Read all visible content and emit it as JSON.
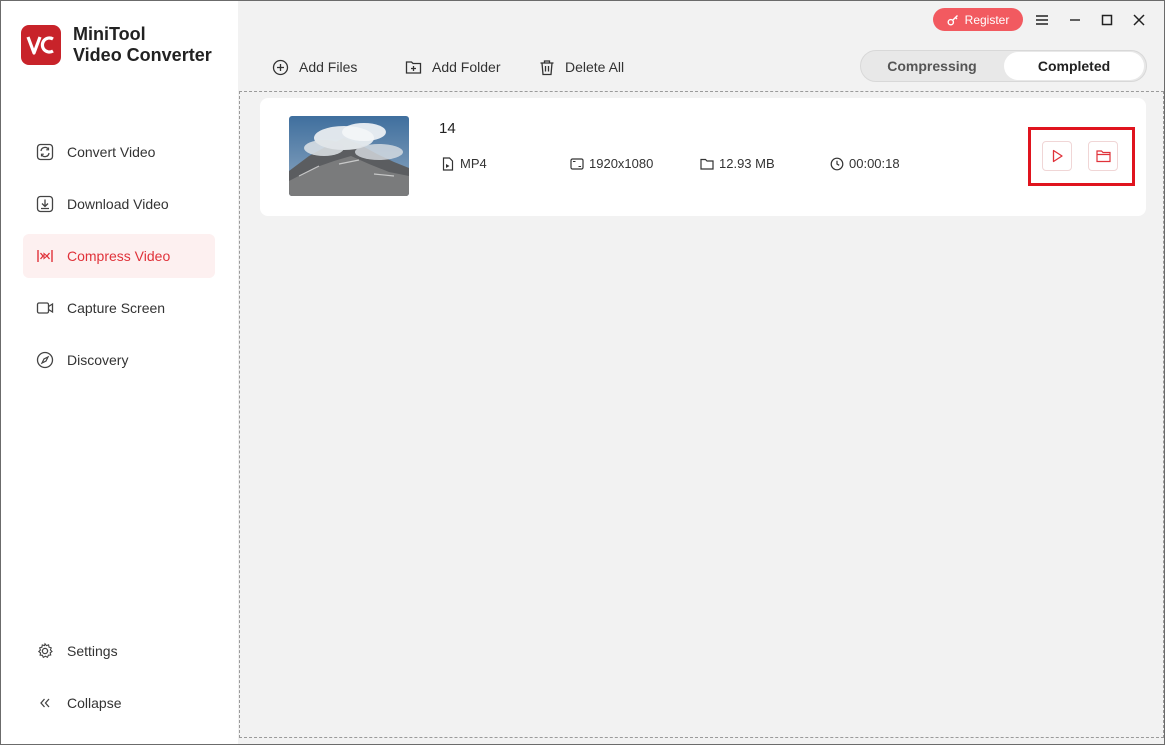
{
  "app": {
    "name_line1": "MiniTool",
    "name_line2": "Video Converter",
    "logo_text": "VC",
    "accent_color": "#e0323a",
    "logo_color": "#c8232a"
  },
  "sidebar": {
    "items": [
      {
        "label": "Convert Video",
        "icon": "convert-icon"
      },
      {
        "label": "Download Video",
        "icon": "download-icon"
      },
      {
        "label": "Compress Video",
        "icon": "compress-icon",
        "active": true
      },
      {
        "label": "Capture Screen",
        "icon": "camera-icon"
      },
      {
        "label": "Discovery",
        "icon": "compass-icon"
      }
    ],
    "bottom": [
      {
        "label": "Settings",
        "icon": "gear-icon"
      },
      {
        "label": "Collapse",
        "icon": "collapse-icon"
      }
    ]
  },
  "titlebar": {
    "register_label": "Register"
  },
  "toolbar": {
    "add_files": "Add Files",
    "add_folder": "Add Folder",
    "delete_all": "Delete All"
  },
  "tabs": {
    "compressing": "Compressing",
    "completed": "Completed",
    "selected": "Completed"
  },
  "files": [
    {
      "name": "14",
      "format": "MP4",
      "resolution": "1920x1080",
      "size": "12.93 MB",
      "duration": "00:00:18"
    }
  ]
}
